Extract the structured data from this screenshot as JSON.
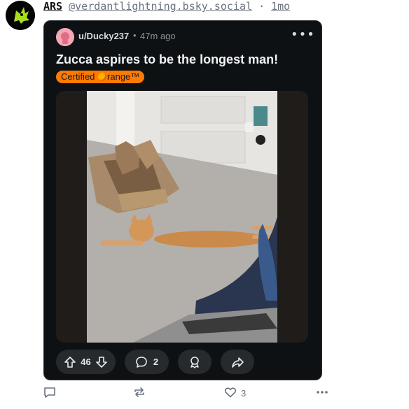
{
  "post": {
    "author_name": "ARS",
    "author_handle": "@verdantlightning.bsky.social",
    "separator": " · ",
    "time": "1mo"
  },
  "card": {
    "subreddit_user": "u/Ducky237",
    "dot": "•",
    "time": "47m ago",
    "more": "•••",
    "title": "Zucca aspires to be the longest man!",
    "flair_before": "Certified ",
    "flair_after": "range™",
    "vote_count": "46",
    "comment_count": "2"
  },
  "footer": {
    "likes": "3"
  },
  "colors": {
    "card_bg": "#0e1113",
    "flair": "#ff7a00",
    "pill": "#272a2d"
  }
}
